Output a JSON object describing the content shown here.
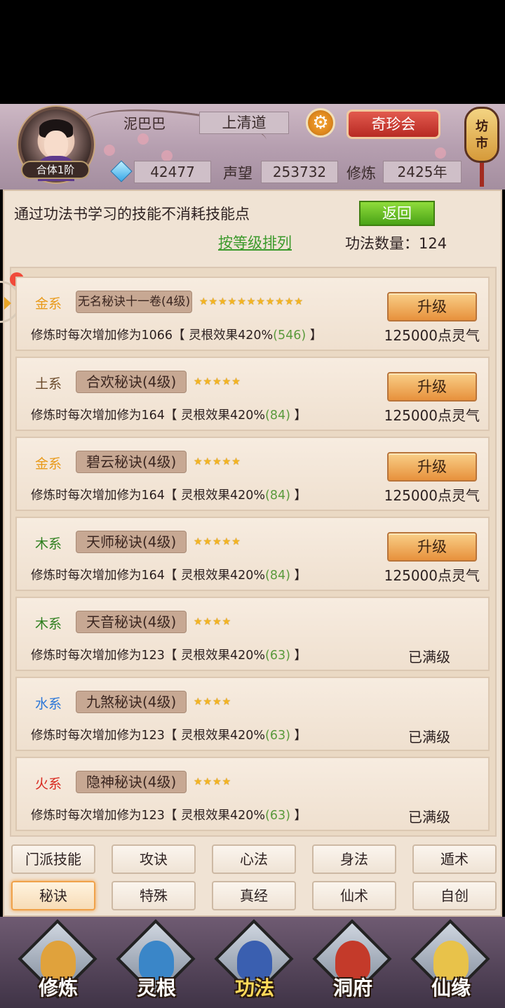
{
  "header": {
    "rank": "合体1阶",
    "username": "泥巴巴",
    "sect": "上清道",
    "qizhen_label": "奇珍会",
    "fangshi_label": "坊市",
    "gems": "42477",
    "prestige_label": "声望",
    "prestige": "253732",
    "cultivation_label": "修炼",
    "cultivation": "2425年"
  },
  "panel": {
    "notice": "通过功法书学习的技能不消耗技能点",
    "back_label": "返回",
    "sort_label": "按等级排列",
    "count_label": "功法数量：124"
  },
  "skills": [
    {
      "element": "金系",
      "element_color": "#e89a1a",
      "name": "无名秘诀十一卷(4级)",
      "stars": "★★★★★★★★★★★",
      "desc_prefix": "修炼时每次增加修为1066【 灵根效果420%",
      "desc_bonus": "(546)",
      "desc_suffix": " 】",
      "button": "升级",
      "cost": "125000点灵气"
    },
    {
      "element": "土系",
      "element_color": "#6b4a2a",
      "name": "合欢秘诀(4级)",
      "stars": "★★★★★",
      "desc_prefix": "修炼时每次增加修为164【 灵根效果420%",
      "desc_bonus": "(84)",
      "desc_suffix": " 】",
      "button": "升级",
      "cost": "125000点灵气"
    },
    {
      "element": "金系",
      "element_color": "#e89a1a",
      "name": "碧云秘诀(4级)",
      "stars": "★★★★★",
      "desc_prefix": "修炼时每次增加修为164【 灵根效果420%",
      "desc_bonus": "(84)",
      "desc_suffix": " 】",
      "button": "升级",
      "cost": "125000点灵气"
    },
    {
      "element": "木系",
      "element_color": "#2e7f1e",
      "name": "天师秘诀(4级)",
      "stars": "★★★★★",
      "desc_prefix": "修炼时每次增加修为164【 灵根效果420%",
      "desc_bonus": "(84)",
      "desc_suffix": " 】",
      "button": "升级",
      "cost": "125000点灵气"
    },
    {
      "element": "木系",
      "element_color": "#2e7f1e",
      "name": "天音秘诀(4级)",
      "stars": "★★★★",
      "desc_prefix": "修炼时每次增加修为123【 灵根效果420%",
      "desc_bonus": "(63)",
      "desc_suffix": " 】",
      "status": "已满级"
    },
    {
      "element": "水系",
      "element_color": "#2a76d8",
      "name": "九煞秘诀(4级)",
      "stars": "★★★★",
      "desc_prefix": "修炼时每次增加修为123【 灵根效果420%",
      "desc_bonus": "(63)",
      "desc_suffix": " 】",
      "status": "已满级"
    },
    {
      "element": "火系",
      "element_color": "#d8281e",
      "name": "隐神秘诀(4级)",
      "stars": "★★★★",
      "desc_prefix": "修炼时每次增加修为123【 灵根效果420%",
      "desc_bonus": "(63)",
      "desc_suffix": " 】",
      "status": "已满级"
    }
  ],
  "tabs": [
    "门派技能",
    "攻诀",
    "心法",
    "身法",
    "遁术",
    "秘诀",
    "特殊",
    "真经",
    "仙术",
    "自创"
  ],
  "active_tab": "秘诀",
  "nav": [
    {
      "label": "修炼",
      "icon": "cultivation-monk-icon"
    },
    {
      "label": "灵根",
      "icon": "spirit-root-sword-icon"
    },
    {
      "label": "功法",
      "icon": "technique-book-icon"
    },
    {
      "label": "洞府",
      "icon": "cave-palace-icon"
    },
    {
      "label": "仙缘",
      "icon": "gourd-yinyang-icon"
    }
  ],
  "active_nav": "功法"
}
